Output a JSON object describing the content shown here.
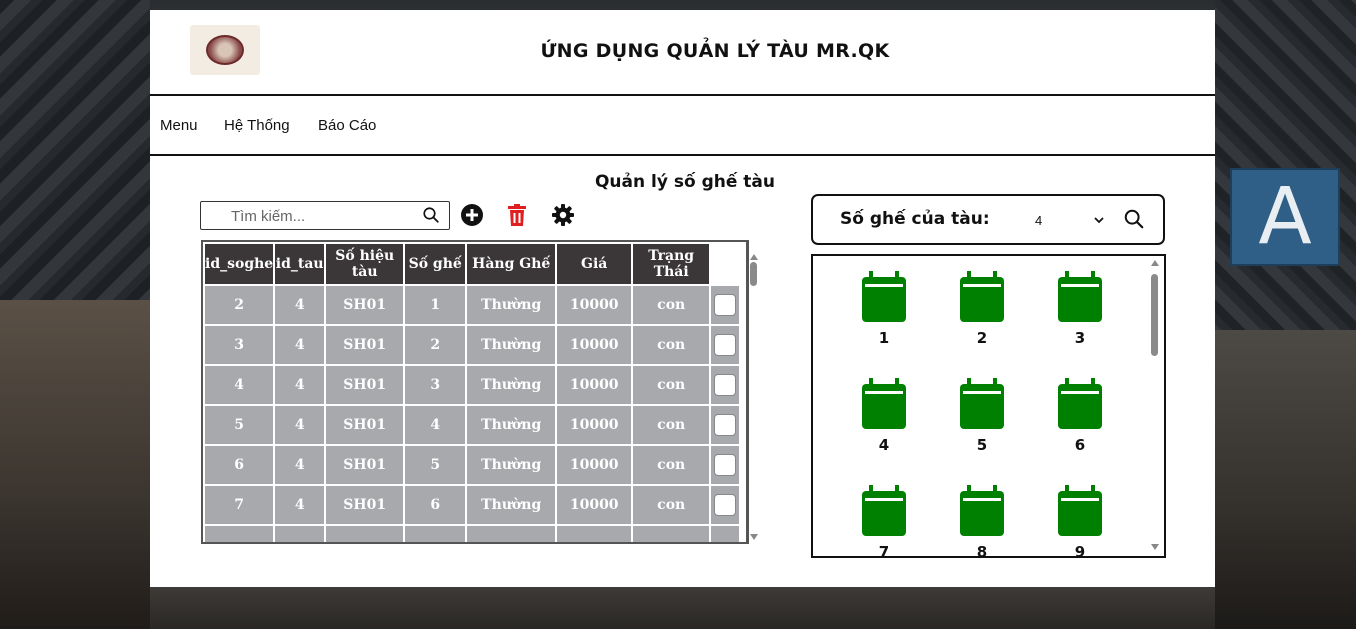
{
  "app": {
    "title": "ỨNG DỤNG QUẢN LÝ TÀU MR.QK"
  },
  "nav": {
    "items": [
      {
        "label": "Menu"
      },
      {
        "label": "Hệ Thống"
      },
      {
        "label": "Báo Cáo"
      }
    ]
  },
  "section": {
    "title": "Quản lý số ghế tàu"
  },
  "search": {
    "placeholder": "Tìm kiếm..."
  },
  "toolbar": {
    "add_icon": "plus-circle-icon",
    "delete_icon": "trash-icon",
    "settings_icon": "gear-icon",
    "delete_color": "#e02020"
  },
  "table": {
    "columns": [
      "id_soghe",
      "id_tau",
      "Số hiệu tàu",
      "Số ghế",
      "Hàng Ghế",
      "Giá",
      "Trạng Thái"
    ],
    "rows": [
      [
        "2",
        "4",
        "SH01",
        "1",
        "Thường",
        "10000",
        "con"
      ],
      [
        "3",
        "4",
        "SH01",
        "2",
        "Thường",
        "10000",
        "con"
      ],
      [
        "4",
        "4",
        "SH01",
        "3",
        "Thường",
        "10000",
        "con"
      ],
      [
        "5",
        "4",
        "SH01",
        "4",
        "Thường",
        "10000",
        "con"
      ],
      [
        "6",
        "4",
        "SH01",
        "5",
        "Thường",
        "10000",
        "con"
      ],
      [
        "7",
        "4",
        "SH01",
        "6",
        "Thường",
        "10000",
        "con"
      ]
    ]
  },
  "seat_panel": {
    "label": "Số ghế của tàu:",
    "selected_train": "4",
    "seat_color": "#008000",
    "seats": [
      "1",
      "2",
      "3",
      "4",
      "5",
      "6",
      "7",
      "8",
      "9"
    ]
  },
  "background": {
    "sign_letter": "A"
  }
}
